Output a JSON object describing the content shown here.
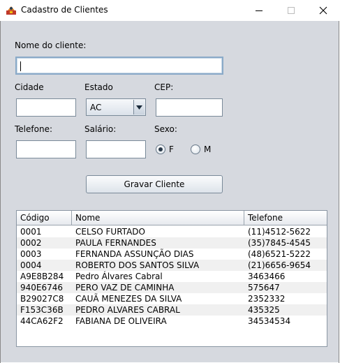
{
  "window": {
    "title": "Cadastro de Clientes",
    "minimize_icon": "minimize-icon",
    "maximize_icon": "maximize-icon",
    "close_icon": "close-icon"
  },
  "form": {
    "nome_label": "Nome do cliente:",
    "nome_value": "",
    "cidade_label": "Cidade",
    "cidade_value": "",
    "estado_label": "Estado",
    "estado_value": "AC",
    "cep_label": "CEP:",
    "cep_value": "",
    "telefone_label": "Telefone:",
    "telefone_value": "",
    "salario_label": "Salário:",
    "salario_value": "",
    "sexo_label": "Sexo:",
    "sexo_f": "F",
    "sexo_m": "M",
    "sexo_selected": "F"
  },
  "actions": {
    "gravar_label": "Gravar Cliente"
  },
  "table": {
    "columns": [
      "Código",
      "Nome",
      "Telefone"
    ],
    "rows": [
      [
        "0001",
        "CELSO FURTADO",
        "(11)4512-5622"
      ],
      [
        "0002",
        "PAULA FERNANDES",
        "(35)7845-4545"
      ],
      [
        "0003",
        "FERNANDA ASSUNÇÃO DIAS",
        "(48)6521-5222"
      ],
      [
        "0004",
        "ROBERTO DOS SANTOS SILVA",
        "(21)6656-9654"
      ],
      [
        "A9E8B284",
        "Pedro Álvares Cabral",
        "3463466"
      ],
      [
        "940E6746",
        "PERO VAZ DE CAMINHA",
        "575647"
      ],
      [
        "B29027C8",
        "CAUÃ MENEZES DA SILVA",
        "2352332"
      ],
      [
        "F153C36B",
        "PEDRO ALVARES CABRAL",
        "435325"
      ],
      [
        "44CA62F2",
        "FABIANA DE OLIVEIRA",
        "34534534"
      ]
    ]
  },
  "colors": {
    "panel_bg": "#d6d9df",
    "input_border": "#7a8a99",
    "focus_border": "#8aaac8"
  }
}
